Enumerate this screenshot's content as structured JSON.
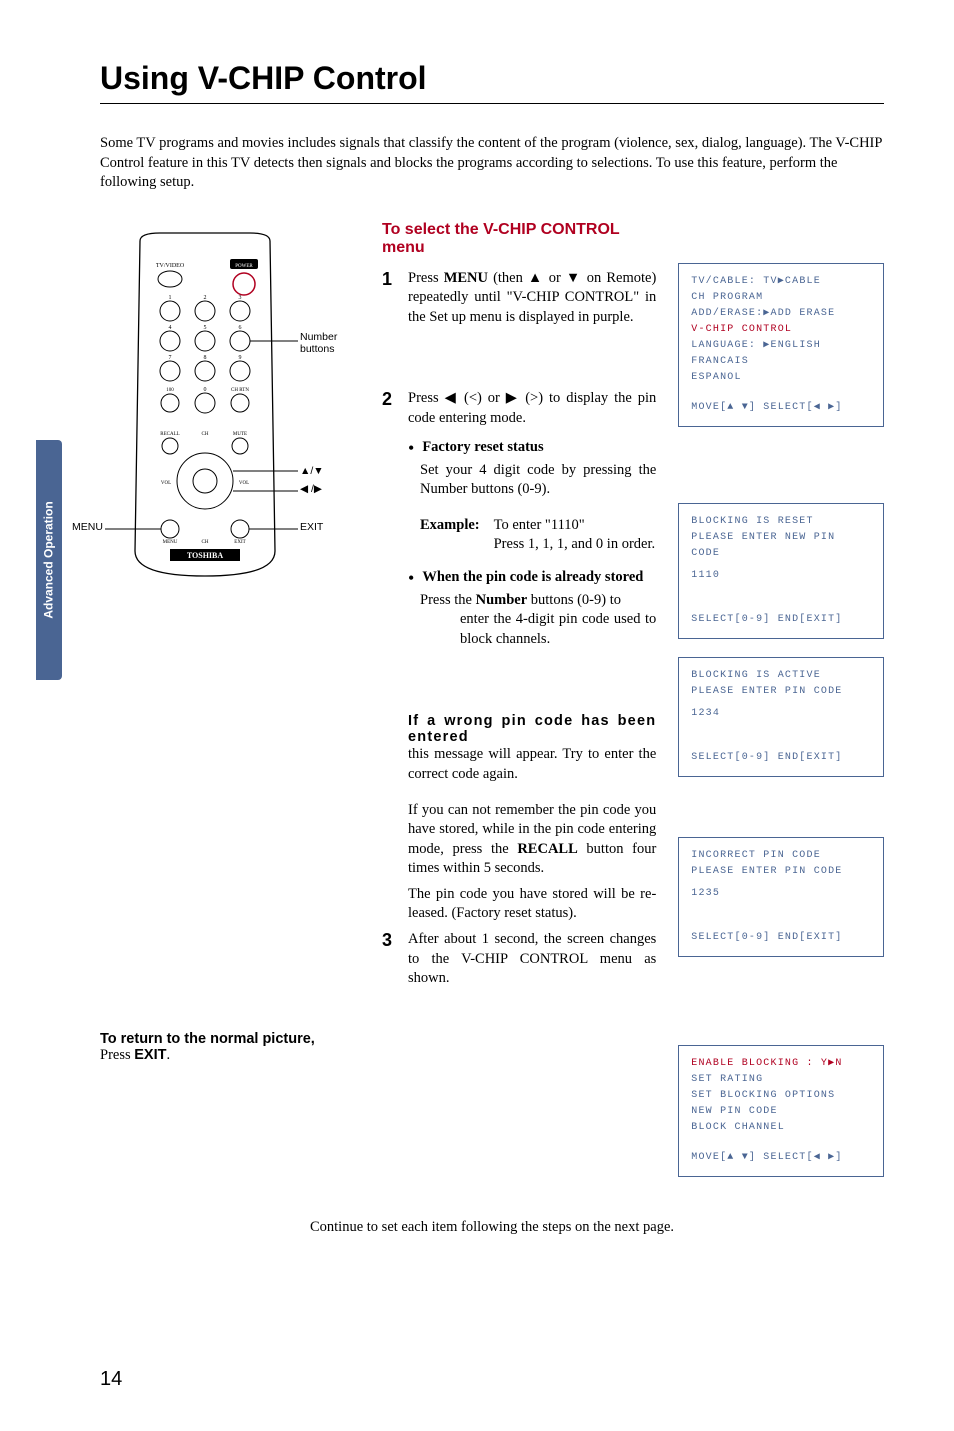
{
  "title": "Using V-CHIP Control",
  "intro": "Some TV programs and movies includes signals that classify the content of the program (violence, sex, dialog, language). The V-CHIP Control feature in this TV detects then signals and blocks the programs according to selections. To use this feature, perform the following setup.",
  "section_head": "To select the V-CHIP CONTROL menu",
  "sidebar_label": "Advanced Operation",
  "remote": {
    "label_number_buttons": "Number buttons",
    "label_menu": "MENU",
    "label_exit": "EXIT",
    "label_arrows1": "▲/▼",
    "label_arrows2": "◀ /▶",
    "brand": "TOSHIBA",
    "tvvideo": "TV/VIDEO",
    "power": "POWER",
    "recall": "RECALL",
    "ch": "CH",
    "mute": "MUTE",
    "vol": "VOL",
    "chrtn": "CH RTN",
    "n100": "100",
    "n0": "0"
  },
  "step1": {
    "num": "1",
    "prefix": "Press ",
    "menu_word": "MENU",
    "rest": " (then ▲ or ▼ on Remote) repeatedly until \"V-CHIP CONTROL\" in the Set up menu is displayed in purple."
  },
  "step2": {
    "num": "2",
    "body": "Press ◀ (<) or ▶ (>) to display the pin code entering mode.",
    "factory_head": "Factory reset status",
    "factory_body": "Set your 4 digit code by pressing the Number buttons (0-9).",
    "example_label": "Example:",
    "example_body1": "To enter \"1110\"",
    "example_body2": "Press 1, 1, 1, and 0 in order.",
    "stored_head": "When the pin code is already stored",
    "stored_l1a": "Press the ",
    "stored_l1b": "Number",
    "stored_l1c": " buttons (0-9) to",
    "stored_l2": "enter the 4-digit pin code used to block channels."
  },
  "wrong": {
    "head": "If a wrong pin code has been entered",
    "p1": "this message will appear. Try to enter the correct code again.",
    "p2a": "If you can not remember the pin code you have stored, while in the pin code entering mode, press the ",
    "p2b": "RECALL",
    "p2c": " button four times within 5 seconds.",
    "p3": "The pin code you have stored will be re-leased. (Factory reset status)."
  },
  "step3": {
    "num": "3",
    "body": "After about 1 second, the screen changes to the V-CHIP CONTROL menu as shown."
  },
  "return_note": {
    "l1": "To return to the normal picture,",
    "l2a": "Press ",
    "l2b": "EXIT",
    "l2c": "."
  },
  "continue_text": "Continue to set each item following the steps on the next page.",
  "page_number": "14",
  "osd1": {
    "l1": "TV/CABLE:  TV▶CABLE",
    "l2": "CH PROGRAM",
    "l3": "ADD/ERASE:▶ADD ERASE",
    "l4": "V-CHIP CONTROL",
    "l5": "LANGUAGE: ▶ENGLISH FRANCAIS",
    "l6": "          ESPANOL",
    "foot": "MOVE[▲ ▼]  SELECT[◀ ▶]"
  },
  "osd2": {
    "l1": "BLOCKING IS RESET",
    "l2": "PLEASE ENTER NEW PIN CODE",
    "l3": " 1110",
    "foot": "SELECT[0-9] END[EXIT]"
  },
  "osd3": {
    "l1": "BLOCKING IS ACTIVE",
    "l2": "PLEASE ENTER PIN CODE",
    "l3": "  1234",
    "foot": "SELECT[0-9] END[EXIT]"
  },
  "osd4": {
    "l1": "INCORRECT PIN CODE",
    "l2": "PLEASE ENTER PIN CODE",
    "l3": "  1235",
    "foot": "SELECT[0-9] END[EXIT]"
  },
  "osd5": {
    "l1": "ENABLE BLOCKING :  Y▶N",
    "l2": "SET RATING",
    "l3": "SET BLOCKING OPTIONS",
    "l4": "NEW PIN CODE",
    "l5": "BLOCK CHANNEL",
    "foot": "MOVE[▲ ▼]  SELECT[◀ ▶]"
  }
}
